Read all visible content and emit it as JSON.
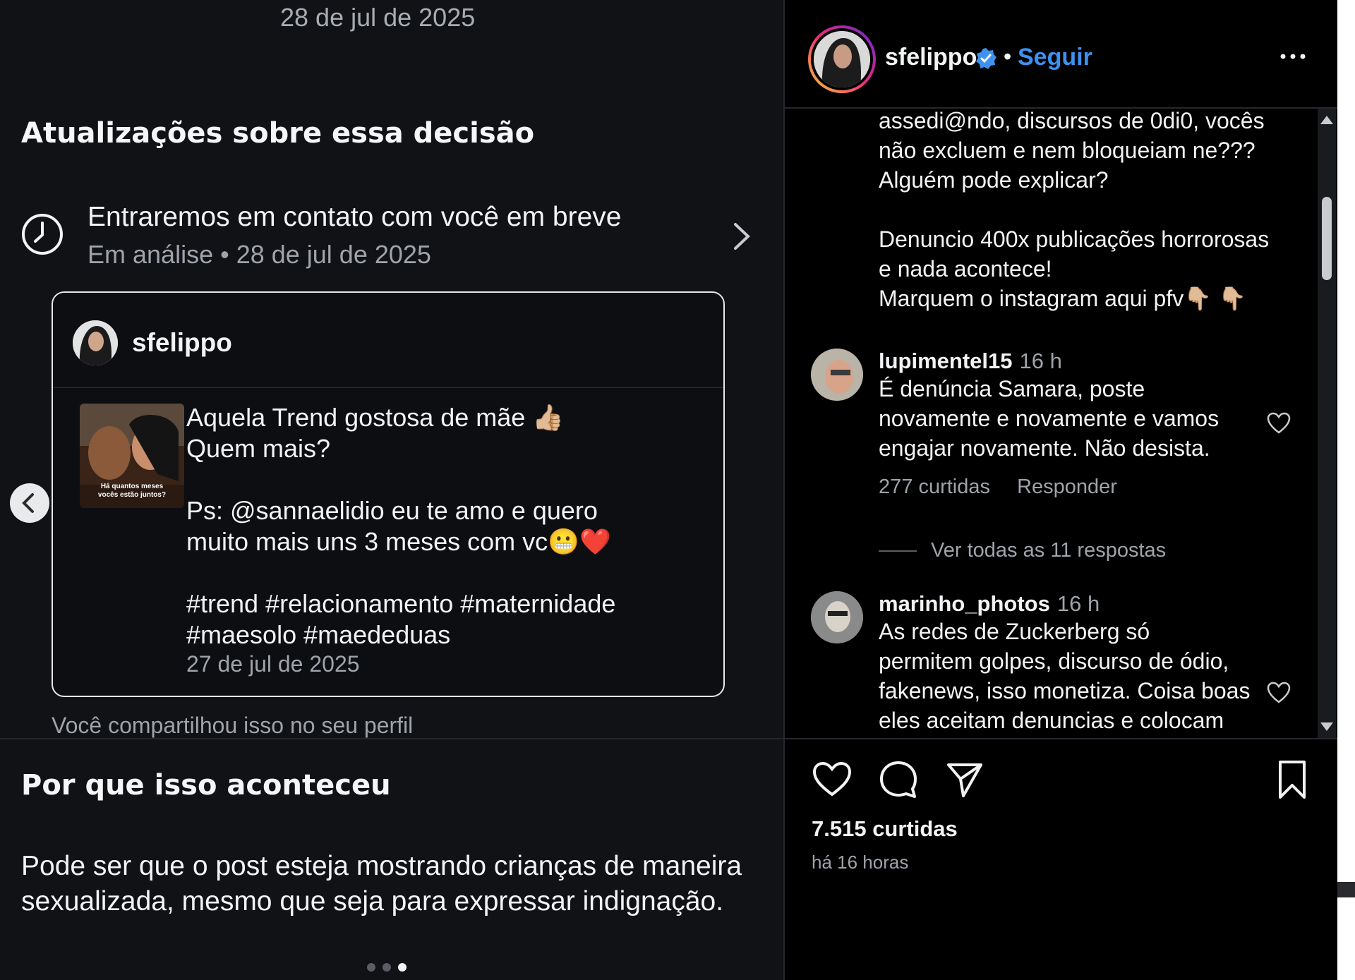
{
  "left": {
    "top_date": "28 de jul de 2025",
    "updates_title": "Atualizações sobre essa decisão",
    "status_main": "Entraremos em contato com você em breve",
    "status_sub": "Em análise • 28 de jul de 2025",
    "card": {
      "username": "sfelippo",
      "thumb_caption": "Há quantos meses vocês estão juntos?",
      "text_lines": [
        "Aquela Trend gostosa de mãe 👍🏼",
        "Quem mais?",
        "",
        "Ps: @sannaelidio eu te amo e quero",
        "muito mais uns 3 meses com vc😬❤️",
        "",
        "#trend #relacionamento #maternidade",
        "#maesolo #maededuas"
      ],
      "date": "27 de jul de 2025"
    },
    "shared_note": "Você compartilhou isso no seu perfil",
    "why_title": "Por que isso aconteceu",
    "why_text": "Pode ser que o post esteja mostrando crianças de maneira sexualizada, mesmo que seja para expressar indignação.",
    "carousel_dots": {
      "count": 3,
      "active": 3
    }
  },
  "right": {
    "username": "sfelippo",
    "separator": "•",
    "follow_label": "Seguir",
    "first_comment_lines": [
      "assedi@ndo, discursos de 0di0, vocês",
      "não excluem e nem bloqueiam ne???",
      "Alguém pode explicar?",
      "",
      "Denuncio 400x publicações horrorosas",
      "e nada acontece!",
      "Marquem o instagram aqui pfv👇🏼 👇🏼"
    ],
    "comments": [
      {
        "user": "lupimentel15",
        "time": "16 h",
        "lines": [
          "É denúncia Samara, poste",
          "novamente e novamente e vamos",
          "engajar novamente. Não desista."
        ],
        "likes": "277 curtidas",
        "reply": "Responder"
      },
      {
        "user": "marinho_photos",
        "time": "16 h",
        "lines": [
          "As redes de Zuckerberg só",
          "permitem golpes, discurso de ódio,",
          "fakenews, isso monetiza. Coisa boas",
          "eles aceitam denuncias e colocam"
        ]
      }
    ],
    "view_replies": "Ver todas as 11 respostas",
    "likes_total": "7.515 curtidas",
    "time_ago": "há 16 horas",
    "icons": [
      "heart-icon",
      "comment-icon",
      "share-icon",
      "bookmark-icon",
      "more-icon",
      "verified-icon"
    ],
    "colors": {
      "follow": "#3d91f0",
      "verified": "#3d91f0"
    }
  }
}
